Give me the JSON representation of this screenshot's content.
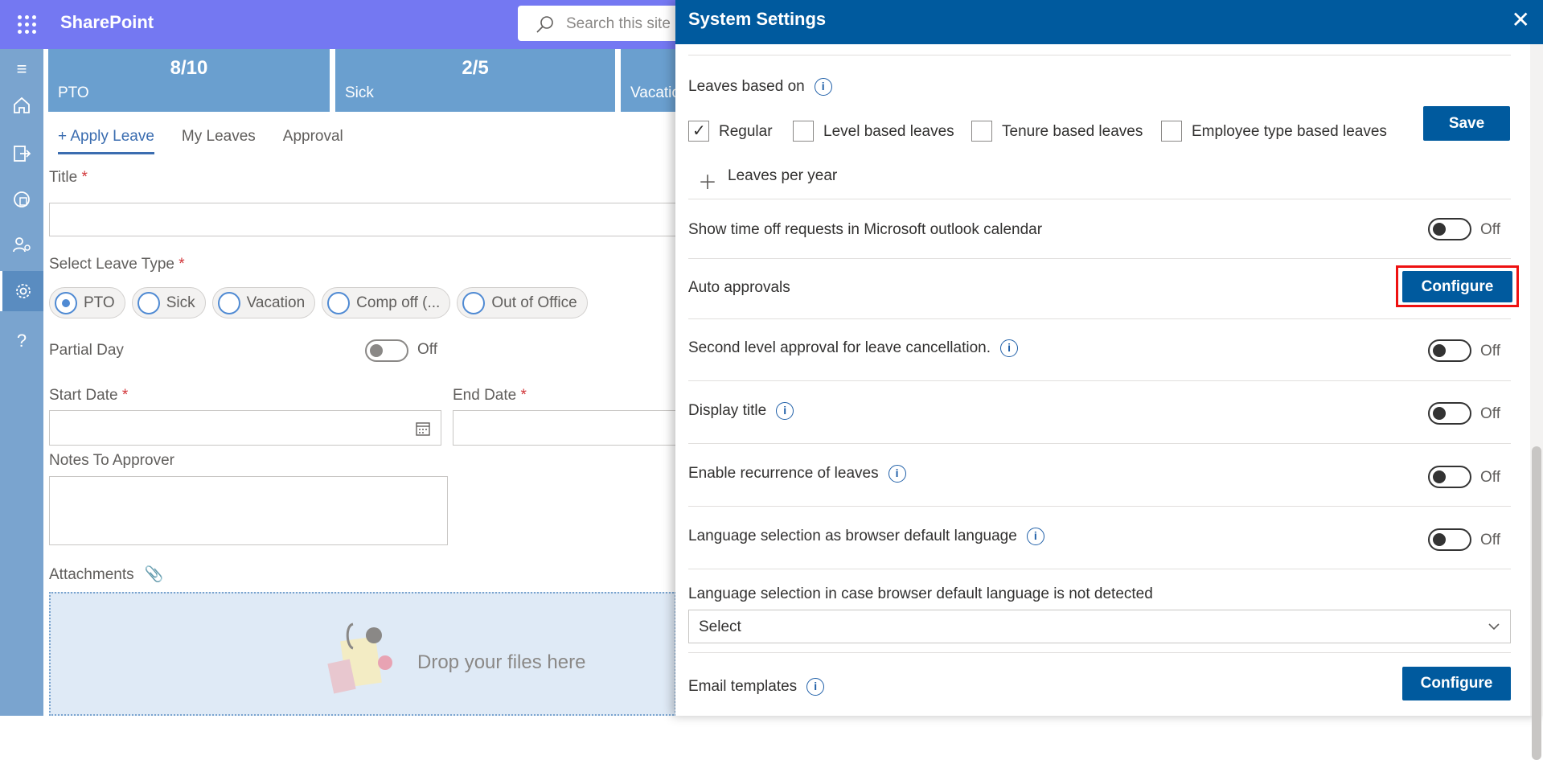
{
  "app": {
    "brand": "SharePoint",
    "search_placeholder": "Search this site"
  },
  "leftnav": [
    "menu-icon",
    "home-icon",
    "export-icon",
    "globe-doc-icon",
    "user-settings-icon",
    "gear-icon",
    "help-icon"
  ],
  "tiles": [
    {
      "num": "8/10",
      "label": "PTO"
    },
    {
      "num": "2/5",
      "label": "Sick"
    },
    {
      "num": "",
      "label": "Vacatio"
    }
  ],
  "tabs": [
    {
      "label": "+ Apply Leave"
    },
    {
      "label": "My Leaves"
    },
    {
      "label": "Approval"
    }
  ],
  "form": {
    "title_label": "Title",
    "leave_type_label": "Select Leave Type",
    "leave_types": [
      "PTO",
      "Sick",
      "Vacation",
      "Comp off (...",
      "Out of Office"
    ],
    "selected_leave_type": "PTO",
    "partial_day_label": "Partial Day",
    "partial_day_state": "Off",
    "start_date_label": "Start Date",
    "end_date_label": "End Date",
    "notes_label": "Notes To Approver",
    "attachments_label": "Attachments",
    "drop_text": "Drop your files here",
    "required_mark": "*"
  },
  "panel": {
    "title": "System Settings",
    "leaves_based_on_label": "Leaves based on",
    "leave_basis_options": [
      {
        "label": "Regular",
        "checked": true
      },
      {
        "label": "Level based leaves",
        "checked": false
      },
      {
        "label": "Tenure based leaves",
        "checked": false
      },
      {
        "label": "Employee type based leaves",
        "checked": false
      }
    ],
    "save_label": "Save",
    "leaves_per_year_label": "Leaves per year",
    "settings": [
      {
        "label": "Show time off requests in Microsoft outlook calendar",
        "state": "Off"
      },
      {
        "label": "Second level approval for leave cancellation.",
        "state": "Off"
      },
      {
        "label": "Display title",
        "state": "Off"
      },
      {
        "label": "Enable recurrence of leaves",
        "state": "Off"
      },
      {
        "label": "Language selection as browser default language",
        "state": "Off"
      }
    ],
    "auto_approvals_label": "Auto approvals",
    "configure_label": "Configure",
    "language_fallback_label": "Language selection in case browser default language is not detected",
    "language_select_value": "Select",
    "email_templates_label": "Email templates",
    "email_configure_label": "Configure"
  }
}
